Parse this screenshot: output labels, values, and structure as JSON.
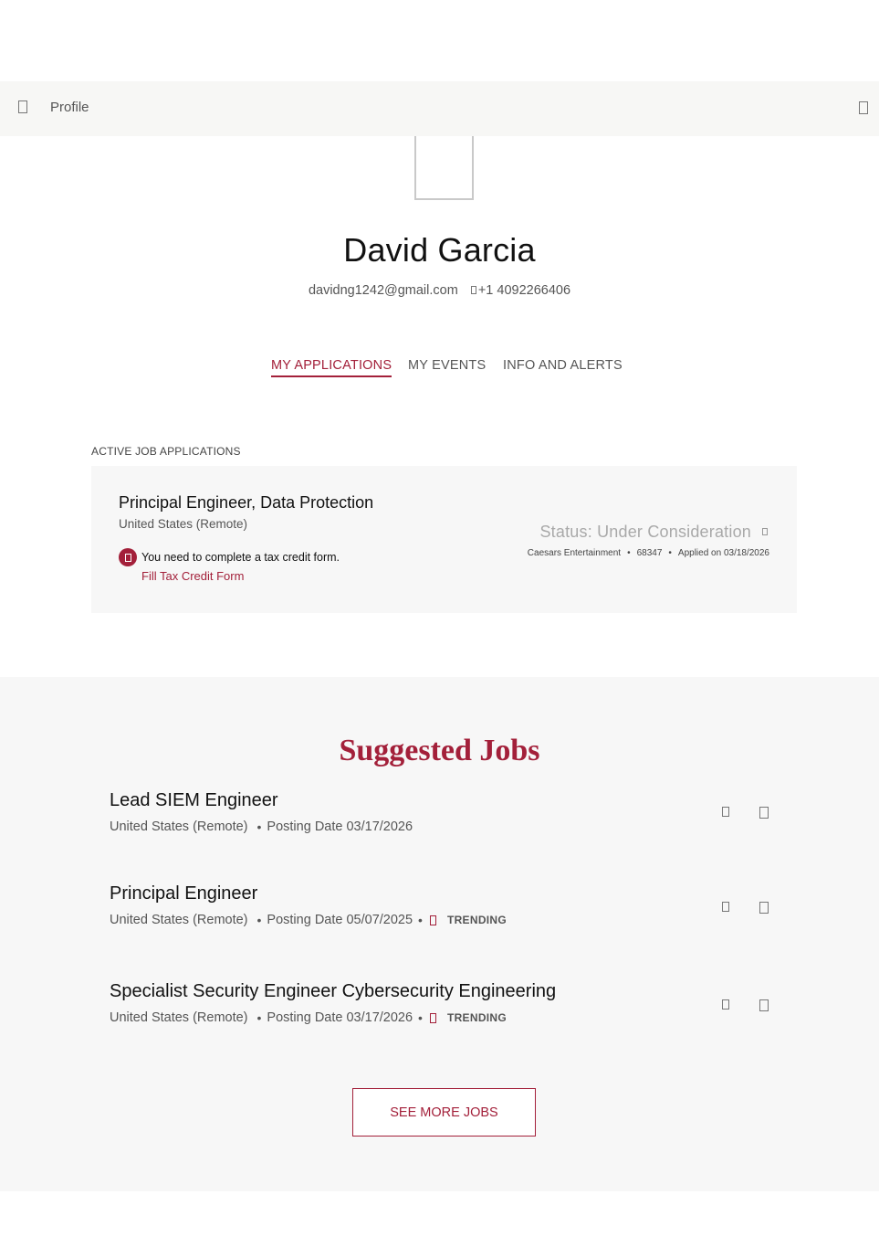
{
  "topbar": {
    "title": "Profile"
  },
  "profile": {
    "name": "David Garcia",
    "email": "davidng1242@gmail.com",
    "phone": "+1 4092266406"
  },
  "tabs": [
    {
      "label": "MY APPLICATIONS",
      "active": true
    },
    {
      "label": "MY EVENTS",
      "active": false
    },
    {
      "label": "INFO AND ALERTS",
      "active": false
    }
  ],
  "applications": {
    "section_label": "ACTIVE JOB APPLICATIONS",
    "items": [
      {
        "title": "Principal Engineer, Data Protection",
        "location": "United States (Remote)",
        "alert_text": "You need to complete a tax credit form.",
        "alert_link": "Fill Tax Credit Form",
        "status": "Status: Under Consideration",
        "company": "Caesars Entertainment",
        "req_id": "68347",
        "applied": "Applied on 03/18/2026"
      }
    ]
  },
  "suggested": {
    "title": "Suggested Jobs",
    "jobs": [
      {
        "title": "Lead SIEM Engineer",
        "location": "United States (Remote)",
        "posting": "Posting Date 03/17/2026",
        "trending": ""
      },
      {
        "title": "Principal Engineer",
        "location": "United States (Remote)",
        "posting": "Posting Date 05/07/2025",
        "trending": "TRENDING"
      },
      {
        "title": "Specialist Security Engineer Cybersecurity Engineering",
        "location": "United States (Remote)",
        "posting": "Posting Date 03/17/2026",
        "trending": "TRENDING"
      }
    ],
    "see_more_label": "SEE MORE JOBS"
  },
  "colors": {
    "accent": "#a3203a",
    "panel_bg": "#f7f7f7"
  },
  "icons": {
    "menu": "menu-icon",
    "topbar_right": "notification-icon",
    "phone": "phone-icon",
    "alert": "alert-icon",
    "status_info": "info-icon",
    "trending": "trending-icon",
    "job_save": "bookmark-icon",
    "job_share": "share-icon"
  }
}
